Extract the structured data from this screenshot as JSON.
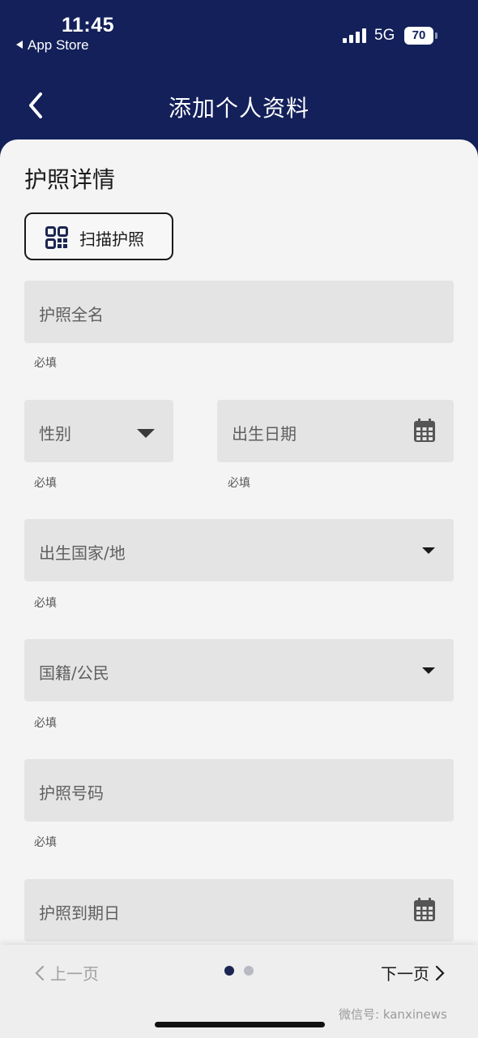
{
  "status_bar": {
    "time": "11:45",
    "back_app": "App Store",
    "network": "5G",
    "battery": "70"
  },
  "nav": {
    "title": "添加个人资料",
    "back_icon": "chevron-left-icon"
  },
  "section": {
    "title": "护照详情"
  },
  "scan_button": {
    "label": "扫描护照",
    "icon": "qr-code-icon"
  },
  "fields": {
    "full_name": {
      "placeholder": "护照全名",
      "helper": "必填"
    },
    "gender": {
      "placeholder": "性别",
      "helper": "必填"
    },
    "dob": {
      "placeholder": "出生日期",
      "helper": "必填"
    },
    "birth_country": {
      "placeholder": "出生国家/地",
      "helper": "必填"
    },
    "nationality": {
      "placeholder": "国籍/公民",
      "helper": "必填"
    },
    "passport_no": {
      "placeholder": "护照号码",
      "helper": "必填"
    },
    "expiry": {
      "placeholder": "护照到期日"
    }
  },
  "footer": {
    "prev": "上一页",
    "next": "下一页",
    "page_total": 2,
    "page_current": 1,
    "watermark": "微信号: kanxinews"
  },
  "colors": {
    "header_bg": "#13205a",
    "dot_active": "#1c2552",
    "dot_inactive": "#b9b9c4"
  }
}
